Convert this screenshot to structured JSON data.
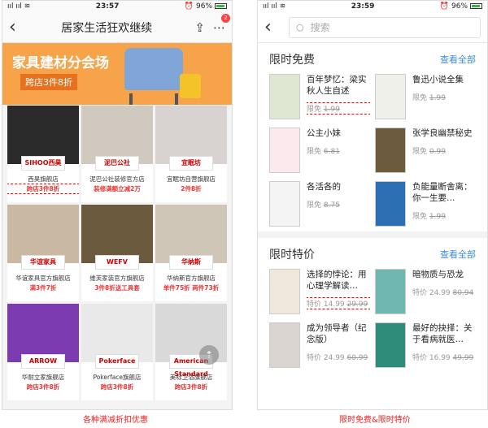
{
  "left": {
    "status": {
      "signal": "))) )))",
      "time": "23:57",
      "right": "⏰ 96%"
    },
    "nav": {
      "title": "居家生活狂欢继续",
      "share_icon": "share-icon",
      "more_icon": "more-icon",
      "badge": "2"
    },
    "banner": {
      "title": "家具建材分会场",
      "subtitle": "跨店3件8折"
    },
    "stores": [
      {
        "name": "西昊旗舰店",
        "promo": "跨店3件8折",
        "logo": "SIHOO西昊",
        "color": "#2a2a2a"
      },
      {
        "name": "泥巴公社装修官方店",
        "promo": "装修满额立减2万",
        "logo": "泥巴公社",
        "color": "#cfc9bf"
      },
      {
        "name": "宜眠坊自营旗舰店",
        "promo": "2件8折",
        "logo": "宜眠坊",
        "color": "#d8d3d1"
      },
      {
        "name": "华谊家具官方旗舰店",
        "promo": "满3件7折",
        "logo": "华谊家具",
        "color": "#c9b9a2"
      },
      {
        "name": "维芙家装官方旗舰店",
        "promo": "3件8折送工具套",
        "logo": "WEFV",
        "color": "#6b5a3e"
      },
      {
        "name": "华纳斯官方旗舰店",
        "promo": "单件75折 两件73折",
        "logo": "华纳斯",
        "color": "#cfc6b8"
      },
      {
        "name": "华耐立家旗舰店",
        "promo": "跨店3件8折",
        "logo": "ARROW",
        "color": "#7c3bb0"
      },
      {
        "name": "Pokerface旗舰店",
        "promo": "跨店3件8折",
        "logo": "Pokerface",
        "color": "#e9e9ea"
      },
      {
        "name": "美标卫浴旗舰店",
        "promo": "跨店3件8折",
        "logo": "American Standard",
        "color": "#d9d9d9"
      }
    ],
    "caption": "各种满减折扣优惠"
  },
  "right": {
    "status": {
      "signal": "))) )))",
      "time": "23:59",
      "right": "⏰ 96%"
    },
    "search_placeholder": "搜索",
    "free": {
      "title": "限时免费",
      "all": "查看全部",
      "books": [
        {
          "title": "百年梦忆：梁实秋人生自述",
          "label": "限免",
          "old": "1.99",
          "cover": "#dfe7d2"
        },
        {
          "title": "鲁迅小说全集",
          "label": "限免",
          "old": "1.99",
          "cover": "#f0f0ea"
        },
        {
          "title": "公主小妹",
          "label": "限免",
          "old": "6.81",
          "cover": "#fbe9ee"
        },
        {
          "title": "张学良幽禁秘史",
          "label": "限免",
          "old": "0.99",
          "cover": "#6d5b3e"
        },
        {
          "title": "各活各的",
          "label": "限免",
          "old": "8.75",
          "cover": "#f4f4f4"
        },
        {
          "title": "负能量断舍离：你一生要…",
          "label": "限免",
          "old": "1.99",
          "cover": "#2c6fb3"
        }
      ]
    },
    "special": {
      "title": "限时特价",
      "all": "查看全部",
      "books": [
        {
          "title": "选择的悖论：用心理学解读…",
          "label": "特价",
          "now": "14.99",
          "old": "29.99",
          "cover": "#efe8dc"
        },
        {
          "title": "暗物质与恐龙",
          "label": "特价",
          "now": "24.99",
          "old": "80.94",
          "cover": "#6fb7b0"
        },
        {
          "title": "成为领导者（纪念版）",
          "label": "特价",
          "now": "24.99",
          "old": "60.99",
          "cover": "#d9d4cf"
        },
        {
          "title": "最好的抉择：关于看病就医…",
          "label": "特价",
          "now": "16.99",
          "old": "49.99",
          "cover": "#2f8b7a"
        }
      ]
    },
    "caption": "限时免费&限时特价"
  }
}
